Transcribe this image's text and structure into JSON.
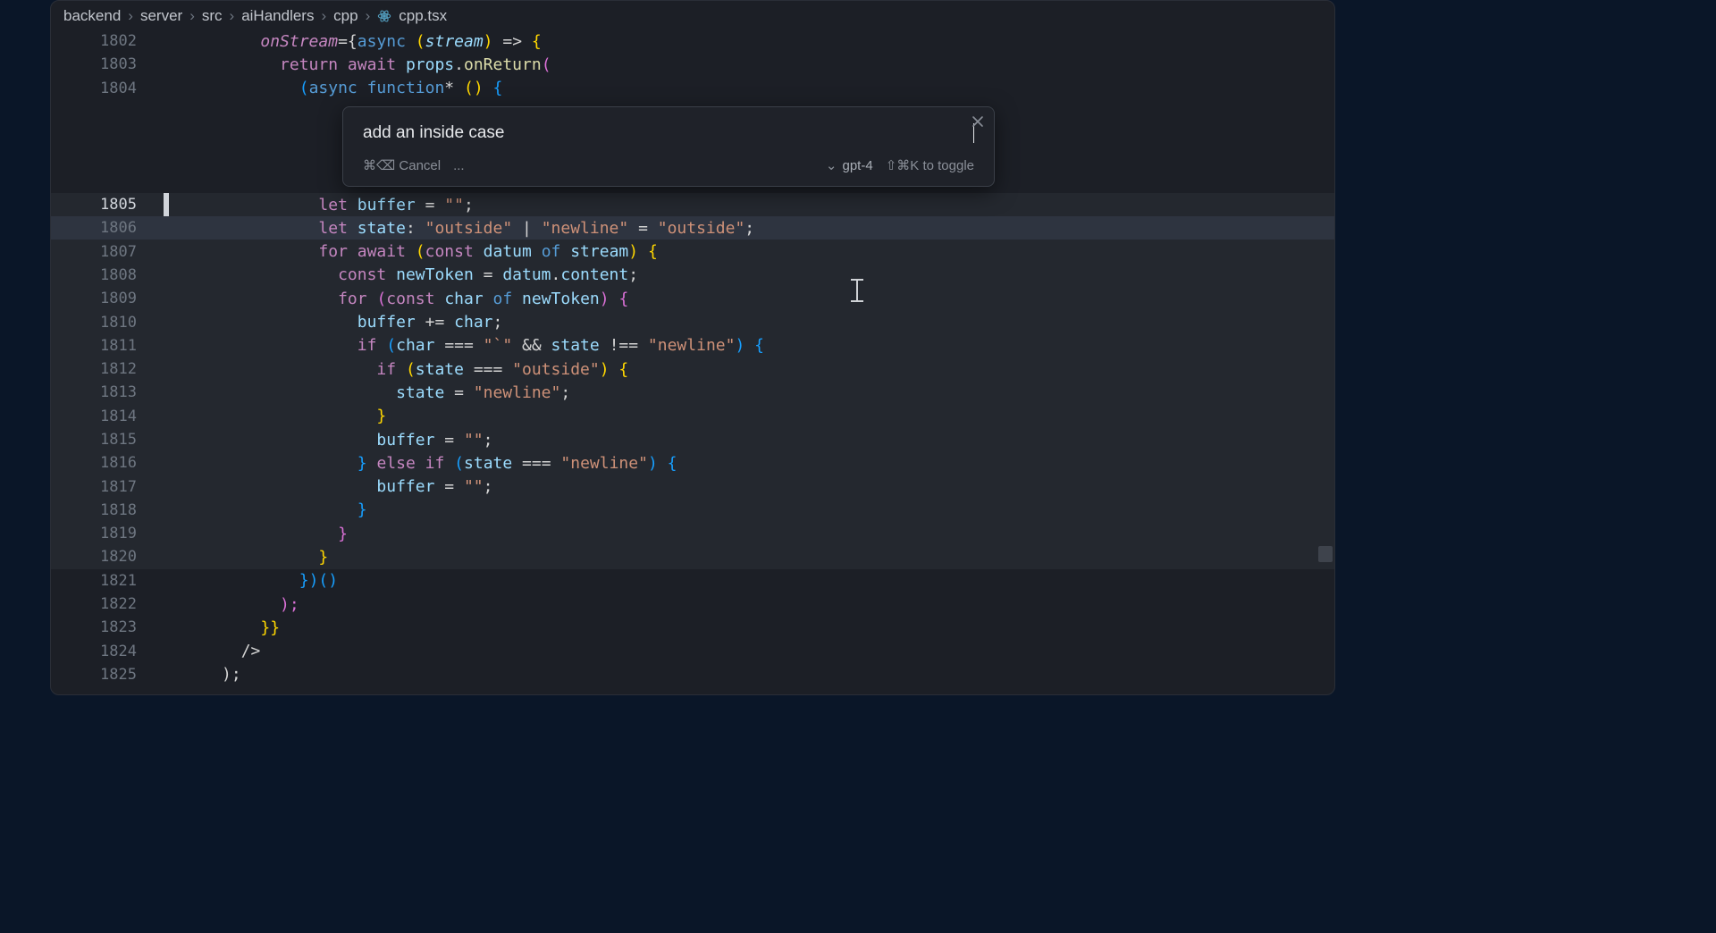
{
  "breadcrumb": {
    "parts": [
      "backend",
      "server",
      "src",
      "aiHandlers",
      "cpp"
    ],
    "file": "cpp.tsx",
    "sep": "›"
  },
  "cmdk": {
    "input_value": "add an inside case",
    "cancel_kbd": "⌘⌫",
    "cancel_label": "Cancel",
    "dots": "...",
    "model": "gpt-4",
    "toggle_kbd": "⇧⌘K",
    "toggle_label": "to toggle"
  },
  "lines": {
    "n1802": "1802",
    "n1803": "1803",
    "n1804": "1804",
    "n1805": "1805",
    "n1806": "1806",
    "n1807": "1807",
    "n1808": "1808",
    "n1809": "1809",
    "n1810": "1810",
    "n1811": "1811",
    "n1812": "1812",
    "n1813": "1813",
    "n1814": "1814",
    "n1815": "1815",
    "n1816": "1816",
    "n1817": "1817",
    "n1818": "1818",
    "n1819": "1819",
    "n1820": "1820",
    "n1821": "1821",
    "n1822": "1822",
    "n1823": "1823",
    "n1824": "1824",
    "n1825": "1825"
  },
  "tok": {
    "onStream": "onStream",
    "eqBrace": "={",
    "async": "async",
    "lparen": "(",
    "rparen": ")",
    "stream": "stream",
    "arrow": " => ",
    "lbrace": "{",
    "rbrace": "}",
    "return": "return",
    "await": "await",
    "props": "props",
    "dot": ".",
    "onReturn": "onReturn",
    "function": "function",
    "star": "*",
    "emptyParens": "()",
    "let": "let",
    "buffer": "buffer",
    "eq": " = ",
    "emptyStr": "\"\"",
    "semi": ";",
    "state": "state",
    "colon": ": ",
    "outside": "\"outside\"",
    "pipe": " | ",
    "newline": "\"newline\"",
    "for": "for",
    "const": "const",
    "datum": "datum",
    "of": "of",
    "newToken": "newToken",
    "datumContent": "content",
    "char": "char",
    "plusEq": " += ",
    "if": "if",
    "eqeqeq": " === ",
    "backtick": "\"`\"",
    "ampamp": " && ",
    "neqeq": " !== ",
    "else": "else",
    "rparenParen": ")()",
    "rparenSemi": ");",
    "rbraceRbrace": "}}",
    "selfClose": "/>",
    "sp": " "
  }
}
